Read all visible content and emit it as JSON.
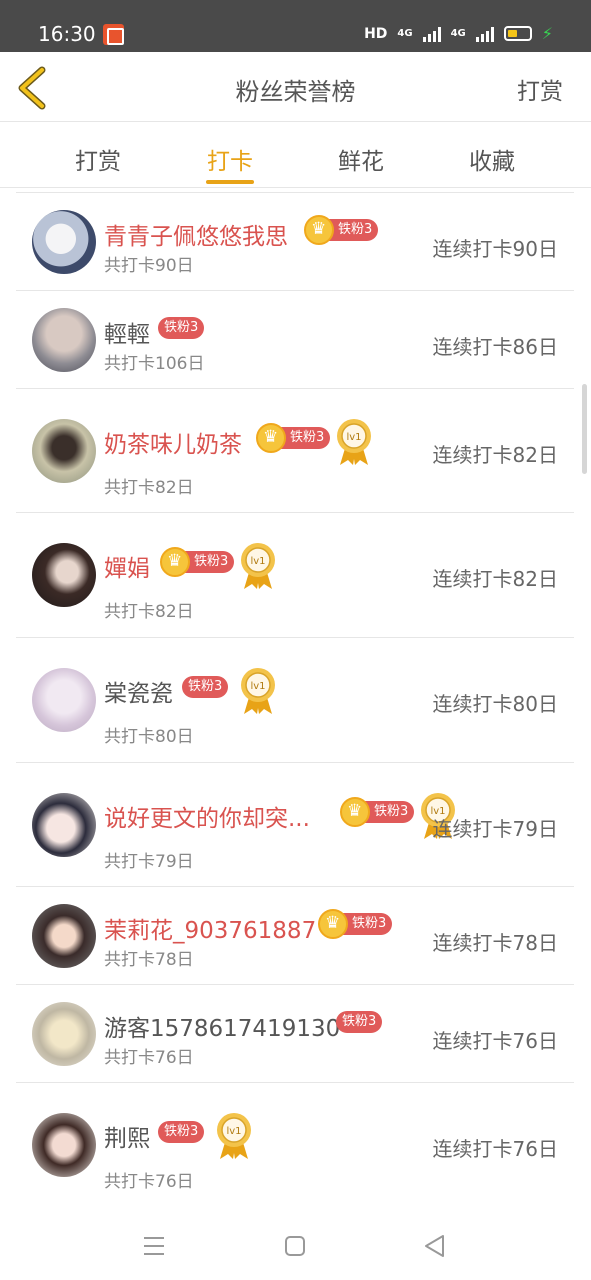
{
  "status": {
    "time": "16:30",
    "hd": "HD",
    "net1": "4G",
    "net2": "4G"
  },
  "header": {
    "title": "粉丝荣誉榜",
    "action": "打赏"
  },
  "tabs": [
    {
      "label": "打赏",
      "active": false
    },
    {
      "label": "打卡",
      "active": true
    },
    {
      "label": "鲜花",
      "active": false
    },
    {
      "label": "收藏",
      "active": false
    }
  ],
  "rows": [
    {
      "name": "青青子佩悠悠我思",
      "highlight": true,
      "crown": true,
      "badge": "铁粉3",
      "medal": false,
      "total": "共打卡90日",
      "streak": "连续打卡90日"
    },
    {
      "name": "輕輕",
      "highlight": false,
      "crown": false,
      "badge": "铁粉3",
      "medal": false,
      "total": "共打卡106日",
      "streak": "连续打卡86日"
    },
    {
      "name": "奶茶味儿奶茶",
      "highlight": true,
      "crown": true,
      "badge": "铁粉3",
      "medal": true,
      "total": "共打卡82日",
      "streak": "连续打卡82日"
    },
    {
      "name": "嬋娟",
      "highlight": true,
      "crown": true,
      "badge": "铁粉3",
      "medal": true,
      "total": "共打卡82日",
      "streak": "连续打卡82日"
    },
    {
      "name": "棠瓷瓷",
      "highlight": false,
      "crown": false,
      "badge": "铁粉3",
      "medal": true,
      "total": "共打卡80日",
      "streak": "连续打卡80日"
    },
    {
      "name": "说好更文的你却突...",
      "highlight": true,
      "crown": true,
      "badge": "铁粉3",
      "medal": true,
      "total": "共打卡79日",
      "streak": "连续打卡79日"
    },
    {
      "name": "茉莉花_903761887",
      "highlight": true,
      "crown": true,
      "badge": "铁粉3",
      "medal": false,
      "total": "共打卡78日",
      "streak": "连续打卡78日"
    },
    {
      "name": "游客1578617419130",
      "highlight": false,
      "crown": false,
      "badge": "铁粉3",
      "medal": false,
      "total": "共打卡76日",
      "streak": "连续打卡76日"
    },
    {
      "name": "荆熙",
      "highlight": false,
      "crown": false,
      "badge": "铁粉3",
      "medal": true,
      "total": "共打卡76日",
      "streak": "连续打卡76日"
    }
  ],
  "medal_label": "lv1",
  "colors": {
    "accent": "#e8a317",
    "name_highlight": "#d9534f",
    "badge": "#e05a59"
  }
}
